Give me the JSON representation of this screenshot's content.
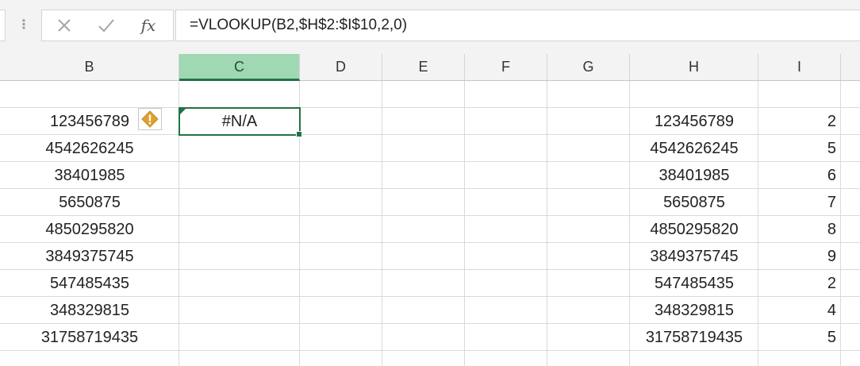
{
  "formula_bar": {
    "formula": "=VLOOKUP(B2,$H$2:$I$10,2,0)",
    "cancel_icon": "close-icon",
    "enter_icon": "check-icon",
    "insert_function_label": "fx"
  },
  "columns": [
    "B",
    "C",
    "D",
    "E",
    "F",
    "G",
    "H",
    "I"
  ],
  "selected_column": "C",
  "active_cell": {
    "ref": "C2",
    "value": "#N/A"
  },
  "warning_icon": "exclamation-diamond-icon",
  "column_b": [
    "123456789",
    "4542626245",
    "38401985",
    "5650875",
    "4850295820",
    "3849375745",
    "547485435",
    "348329815",
    "31758719435"
  ],
  "column_h": [
    "123456789",
    "4542626245",
    "38401985",
    "5650875",
    "4850295820",
    "3849375745",
    "547485435",
    "348329815",
    "31758719435"
  ],
  "column_i": [
    "2",
    "5",
    "6",
    "7",
    "8",
    "9",
    "2",
    "4",
    "5"
  ],
  "colors": {
    "accent": "#217346",
    "selected_header": "#a0d8b3",
    "warning": "#e0a030"
  }
}
